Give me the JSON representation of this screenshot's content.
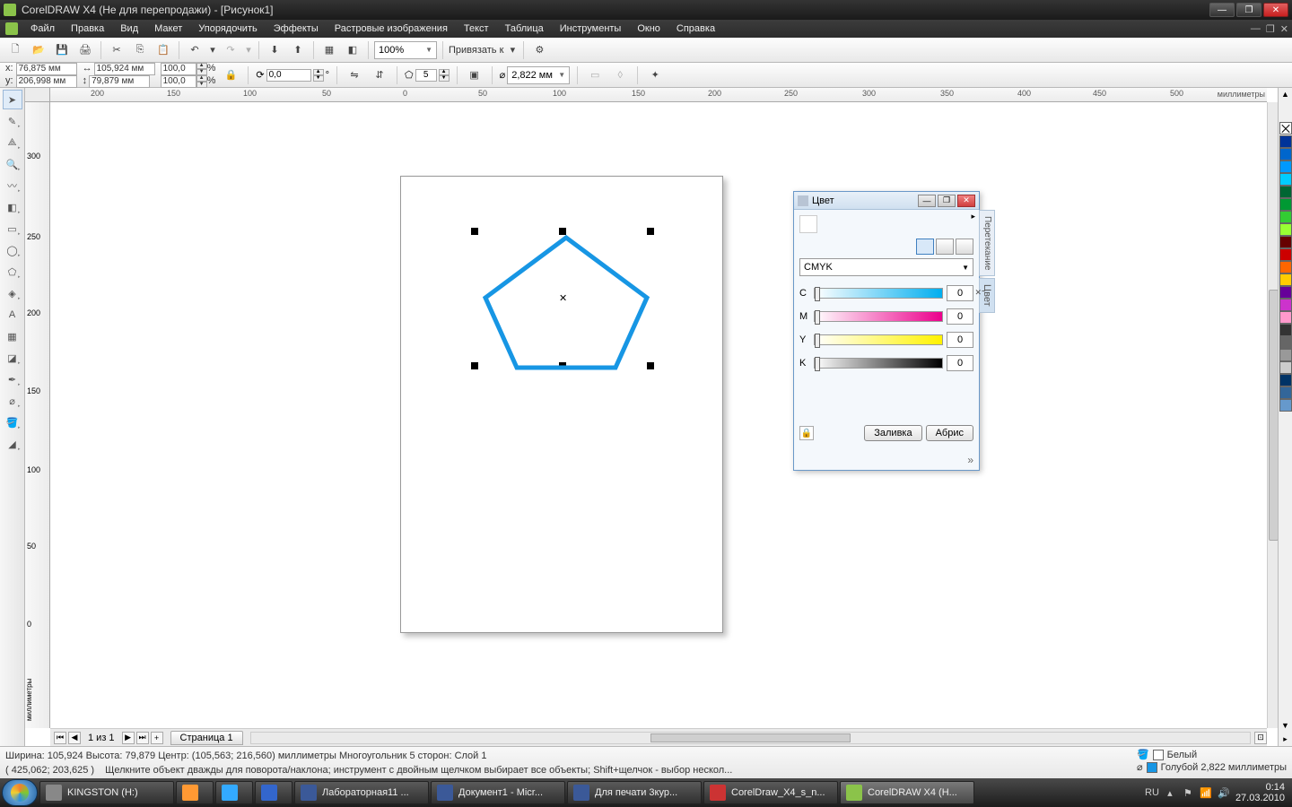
{
  "window": {
    "title": "CorelDRAW X4 (Не для перепродажи) - [Рисунок1]"
  },
  "menu": {
    "items": [
      "Файл",
      "Правка",
      "Вид",
      "Макет",
      "Упорядочить",
      "Эффекты",
      "Растровые изображения",
      "Текст",
      "Таблица",
      "Инструменты",
      "Окно",
      "Справка"
    ]
  },
  "toolbar": {
    "zoom": "100%",
    "snap_label": "Привязать к"
  },
  "propbar": {
    "x_label": "x:",
    "y_label": "y:",
    "x": "76,875 мм",
    "y": "206,998 мм",
    "w": "105,924 мм",
    "h": "79,879 мм",
    "scale_x": "100,0",
    "scale_y": "100,0",
    "pct": "%",
    "rotation": "0,0",
    "deg": "°",
    "sides": "5",
    "outline_width": "2,822 мм"
  },
  "ruler": {
    "hticks": [
      "200",
      "150",
      "100",
      "50",
      "0",
      "50",
      "100",
      "150",
      "200",
      "250",
      "300",
      "350",
      "400",
      "450",
      "500"
    ],
    "vticks": [
      "300",
      "250",
      "200",
      "150",
      "100",
      "50",
      "0"
    ],
    "unit": "миллиметры"
  },
  "pagenav": {
    "counter": "1 из 1",
    "tab": "Страница 1"
  },
  "docker": {
    "title": "Цвет",
    "side_tab1": "Перетекание",
    "side_tab2": "Цвет",
    "model": "CMYK",
    "c_label": "C",
    "m_label": "M",
    "y_label": "Y",
    "k_label": "K",
    "c": "0",
    "m": "0",
    "y": "0",
    "k": "0",
    "fill_btn": "Заливка",
    "outline_btn": "Абрис"
  },
  "status": {
    "line1": "Ширина: 105,924  Высота: 79,879  Центр: (105,563; 216,560)  миллиметры      Многоугольник  5 сторон: Слой 1",
    "coords": "( 425,062; 203,625 )",
    "hint": "Щелкните объект дважды для поворота/наклона; инструмент с двойным щелчком выбирает все объекты; Shift+щелчок - выбор нескол...",
    "fill_label": "Белый",
    "outline_label": "Голубой  2,822 миллиметры"
  },
  "palette_colors": [
    "#003399",
    "#0066cc",
    "#0099ff",
    "#00ccff",
    "#006633",
    "#009933",
    "#33cc33",
    "#99ff33",
    "#660000",
    "#cc0000",
    "#ff6600",
    "#ffcc00",
    "#660099",
    "#cc33cc",
    "#ff99cc",
    "#333333",
    "#666666",
    "#999999",
    "#cccccc",
    "#003366",
    "#336699",
    "#6699cc"
  ],
  "taskbar": {
    "items": [
      {
        "label": "KINGSTON (H:)",
        "color": "#888"
      },
      {
        "label": "",
        "color": "#ff9933"
      },
      {
        "label": "",
        "color": "#33aaff"
      },
      {
        "label": "",
        "color": "#3366cc"
      },
      {
        "label": "Лабораторная11 ...",
        "color": "#3b5998"
      },
      {
        "label": "Документ1 - Micr...",
        "color": "#3b5998"
      },
      {
        "label": "Для печати 3кур...",
        "color": "#3b5998"
      },
      {
        "label": "CorelDraw_X4_s_n...",
        "color": "#cc3333"
      },
      {
        "label": "CorelDRAW X4 (Н...",
        "color": "#8bc34a"
      }
    ],
    "lang": "RU",
    "time": "0:14",
    "date": "27.03.2010"
  }
}
